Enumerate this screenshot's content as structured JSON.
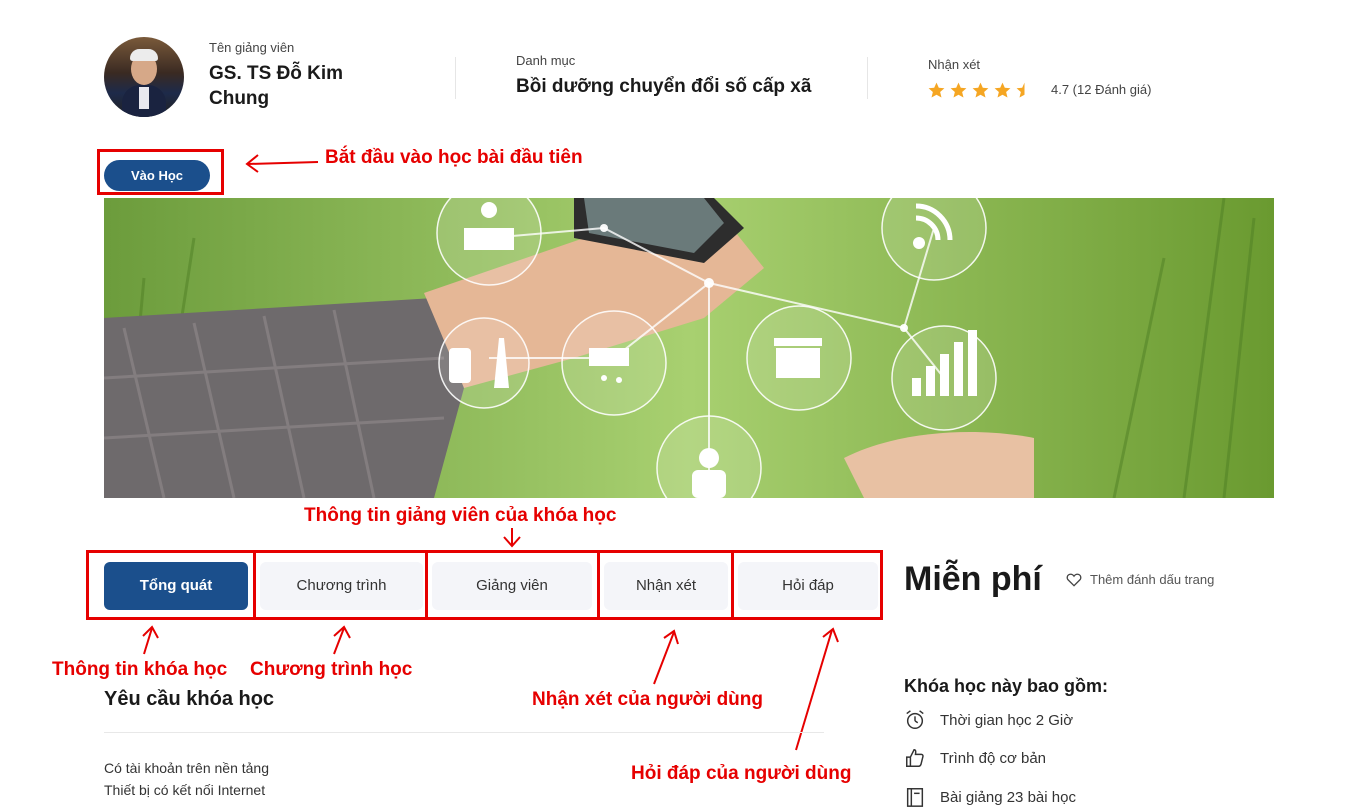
{
  "course": {
    "lecturer_label": "Tên giảng viên",
    "lecturer_name_line1": "GS. TS Đỗ Kim",
    "lecturer_name_line2": "Chung",
    "category_label": "Danh mục",
    "category_value": "Bồi dưỡng chuyển đổi số cấp xã",
    "reviews_label": "Nhận xét",
    "rating_value": 4.7,
    "rating_text": "4.7 (12 Đánh giá)"
  },
  "actions": {
    "start_button": "Vào Học"
  },
  "tabs": [
    {
      "label": "Tổng quát",
      "active": true
    },
    {
      "label": "Chương trình",
      "active": false
    },
    {
      "label": "Giảng viên",
      "active": false
    },
    {
      "label": "Nhận xét",
      "active": false
    },
    {
      "label": "Hỏi đáp",
      "active": false
    }
  ],
  "sidebar": {
    "price": "Miễn phí",
    "bookmark_label": "Thêm đánh dấu trang",
    "includes_title": "Khóa học này bao gồm:",
    "includes": [
      {
        "icon": "alarm-clock-icon",
        "text": "Thời gian học 2 Giờ"
      },
      {
        "icon": "thumbs-up-icon",
        "text": "Trình độ cơ bản"
      },
      {
        "icon": "book-icon",
        "text": "Bài giảng 23 bài học"
      }
    ]
  },
  "requirements": {
    "title": "Yêu cầu khóa học",
    "items": [
      "Có tài khoản trên nền tảng",
      "Thiết bị có kết nối Internet"
    ]
  },
  "annotations": {
    "start": "Bắt đầu vào học bài đầu tiên",
    "lecturer_info": "Thông tin giảng viên của khóa học",
    "course_info": "Thông tin khóa học",
    "program": "Chương trình học",
    "user_reviews": "Nhận xét của người dùng",
    "user_qa": "Hỏi đáp của người dùng"
  },
  "colors": {
    "primary": "#1b4f8c",
    "annotation_red": "#e60000",
    "star": "#f5a623"
  }
}
